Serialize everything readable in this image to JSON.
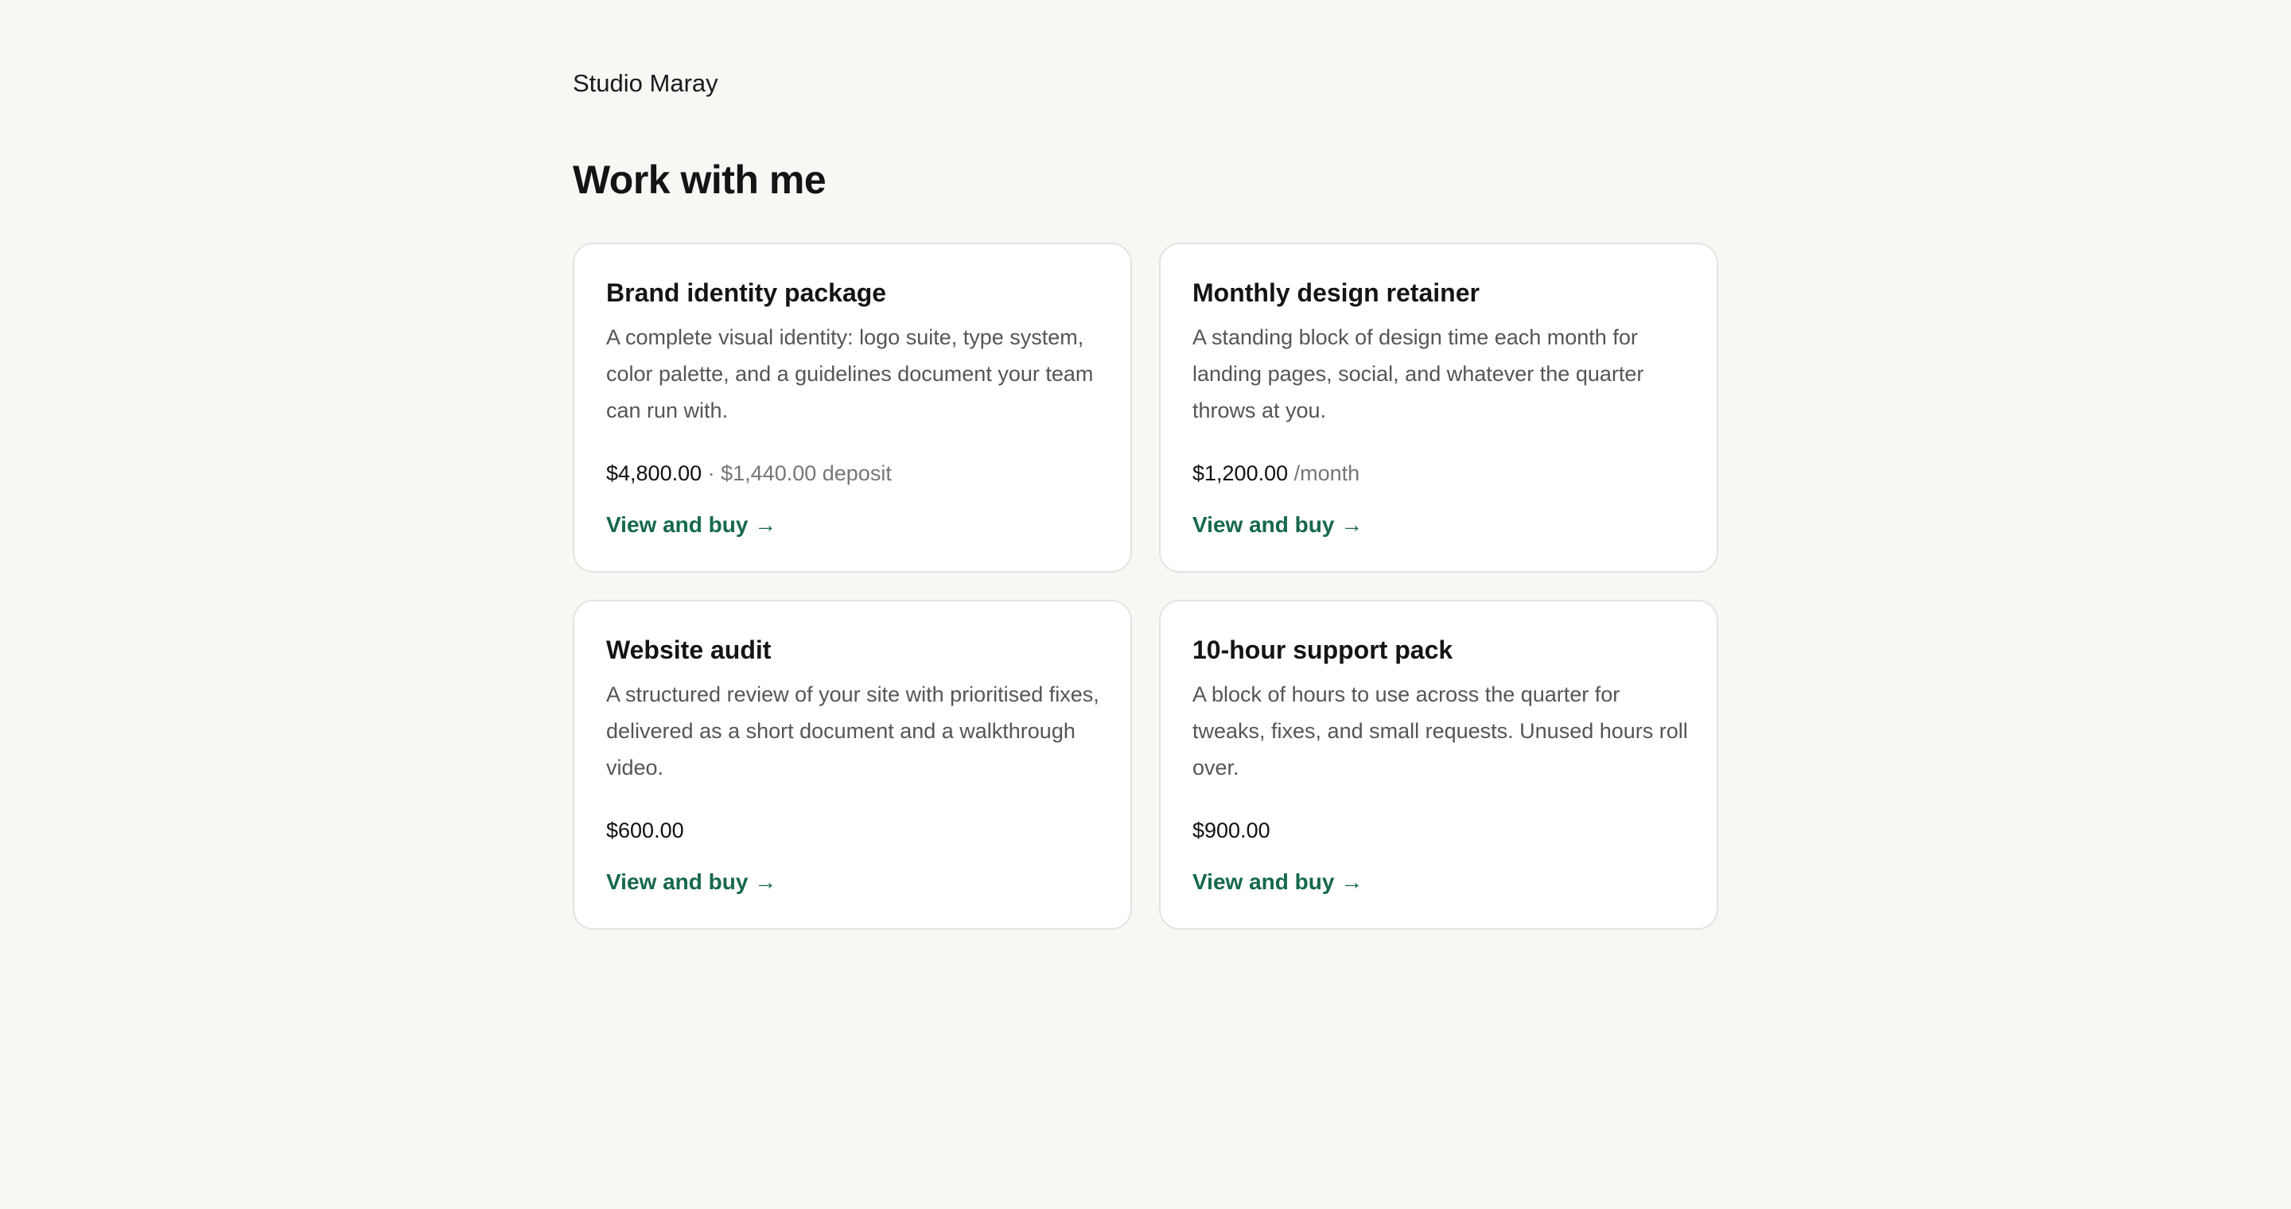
{
  "site": {
    "brand": "Studio Maray"
  },
  "main": {
    "heading": "Work with me",
    "cards": [
      {
        "title": "Brand identity package",
        "description": "A complete visual identity: logo suite, type system, color palette, and a guidelines document your team can run with.",
        "price": "$4,800.00",
        "price_extra": "· $1,440.00 deposit",
        "link_label": "View and buy →"
      },
      {
        "title": "Monthly design retainer",
        "description": "A standing block of design time each month for landing pages, social, and whatever the quarter throws at you.",
        "price": "$1,200.00",
        "price_extra": "/month",
        "link_label": "View and buy →"
      },
      {
        "title": "Website audit",
        "description": "A structured review of your site with prioritised fixes, delivered as a short document and a walkthrough video.",
        "price": "$600.00",
        "price_extra": "",
        "link_label": "View and buy →"
      },
      {
        "title": "10-hour support pack",
        "description": "A block of hours to use across the quarter for tweaks, fixes, and small requests. Unused hours roll over.",
        "price": "$900.00",
        "price_extra": "",
        "link_label": "View and buy →"
      }
    ]
  },
  "colors": {
    "background": "#f7f7f4",
    "card": "#ffffff",
    "accent": "#16694a",
    "muted": "#767676"
  }
}
